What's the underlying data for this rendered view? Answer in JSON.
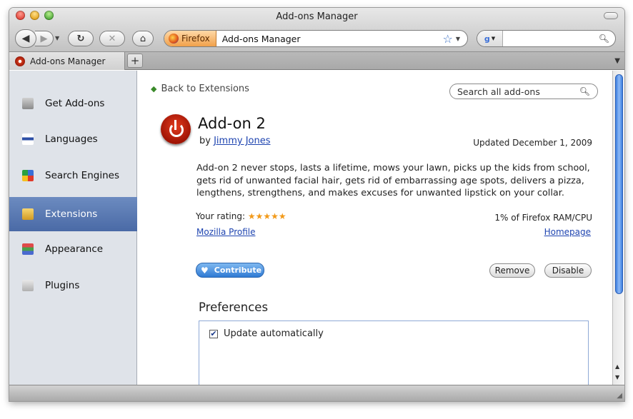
{
  "window": {
    "title": "Add-ons Manager"
  },
  "toolbar": {
    "identity_label": "Firefox",
    "url": "Add-ons Manager",
    "search_engine_icon": "google-icon",
    "search_placeholder": ""
  },
  "tabs": [
    {
      "label": "Add-ons Manager"
    }
  ],
  "sidebar": {
    "items": [
      {
        "label": "Get Add-ons",
        "icon": "get-addons-icon"
      },
      {
        "label": "Languages",
        "icon": "languages-icon"
      },
      {
        "label": "Search Engines",
        "icon": "search-engines-icon"
      },
      {
        "label": "Extensions",
        "icon": "extensions-icon",
        "selected": true
      },
      {
        "label": "Appearance",
        "icon": "appearance-icon"
      },
      {
        "label": "Plugins",
        "icon": "plugins-icon"
      }
    ]
  },
  "detail": {
    "back_label": "Back to Extensions",
    "search_placeholder": "Search all add-ons",
    "name": "Add-on 2",
    "by_prefix": "by",
    "author": "Jimmy Jones",
    "updated": "Updated December 1, 2009",
    "description": "Add-on 2 never stops, lasts a lifetime, mows your lawn, picks up the kids from school, gets rid of unwanted facial hair, gets rid of embarrassing age spots, delivers a pizza, lengthens, strengthens, and makes excuses for unwanted lipstick on your collar.",
    "rating_label": "Your rating:",
    "rating": 5,
    "rating_max": 5,
    "resource_usage": "1% of Firefox RAM/CPU",
    "profile_link": "Mozilla Profile",
    "homepage_link": "Homepage",
    "contribute_label": "Contribute",
    "remove_label": "Remove",
    "disable_label": "Disable",
    "preferences_title": "Preferences",
    "preferences": [
      {
        "label": "Update automatically",
        "checked": true
      }
    ]
  },
  "colors": {
    "accent": "#4a6aa6",
    "link": "#1e44b0",
    "star": "#f29a1a"
  }
}
